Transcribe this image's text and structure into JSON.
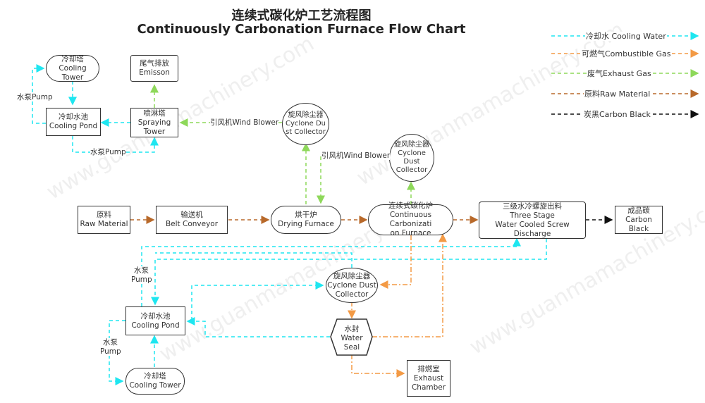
{
  "title": {
    "zh": "连续式碳化炉工艺流程图",
    "en": "Continuously Carbonation Furnace Flow Chart"
  },
  "watermark": "www.guanmamachinery.com",
  "colors": {
    "cooling_water": "#1ee6f0",
    "combustible_gas": "#f39a45",
    "exhaust_gas": "#8ed85a",
    "raw_material": "#b8692a",
    "carbon_black": "#111111"
  },
  "legend": [
    {
      "key": "cooling_water",
      "label": "冷却水 Cooling Water"
    },
    {
      "key": "combustible_gas",
      "label": "可燃气Combustible Gas"
    },
    {
      "key": "exhaust_gas",
      "label": "废气Exhaust Gas"
    },
    {
      "key": "raw_material",
      "label": "原料Raw Material"
    },
    {
      "key": "carbon_black",
      "label": "炭黑Carbon Black"
    }
  ],
  "nodes": {
    "cooling_tower_top": {
      "zh": "冷却塔",
      "en": "Cooling\nTower"
    },
    "emission": {
      "zh": "尾气排放",
      "en": "Emisson"
    },
    "cooling_pond_top": {
      "zh": "冷却水池",
      "en": "Cooling Pond"
    },
    "spraying_tower": {
      "zh": "喷淋塔",
      "en": "Spraying\nTower"
    },
    "cyclone_1": {
      "zh": "旋风除尘器",
      "en": "Cyclone Du\nst Collector"
    },
    "cyclone_2": {
      "zh": "旋风除尘器",
      "en": "Cyclone\nDust\nCollector"
    },
    "raw_material": {
      "zh": "原料",
      "en": "Raw Material"
    },
    "belt_conveyor": {
      "zh": "输送机",
      "en": "Belt Conveyor"
    },
    "drying_furnace": {
      "zh": "烘干炉",
      "en": "Drying Furnace"
    },
    "carbonization_furnace": {
      "zh": "连续式碳化炉",
      "en": "Continuous Carbonizati\non Furnace"
    },
    "screw_discharge": {
      "zh": "三级水冷螺旋出料",
      "en": "Three Stage\nWater Cooled Screw Discharge"
    },
    "carbon_black": {
      "zh": "成品碳",
      "en": "Carbon\nBlack"
    },
    "cyclone_3": {
      "zh": "旋风除尘器",
      "en": "Cyclone Dust\nCollector"
    },
    "cooling_pond_bottom": {
      "zh": "冷却水池",
      "en": "Cooling Pond"
    },
    "water_seal": {
      "zh": "水封",
      "en": "Water\nSeal"
    },
    "cooling_tower_bottom": {
      "zh": "冷却塔",
      "en": "Cooling Tower"
    },
    "exhaust_chamber": {
      "zh": "排燃室",
      "en": "Exhaust\nChamber"
    }
  },
  "edge_labels": {
    "pump_top_left": "水泵Pump",
    "pump_top_bottom": "水泵Pump",
    "wind_blower_1": "引风机Wind Blower",
    "wind_blower_2": "引风机Wind Blower",
    "pump_mid_zh": "水泵",
    "pump_mid_en": "Pump",
    "pump_low_zh": "水泵",
    "pump_low_en": "Pump"
  }
}
